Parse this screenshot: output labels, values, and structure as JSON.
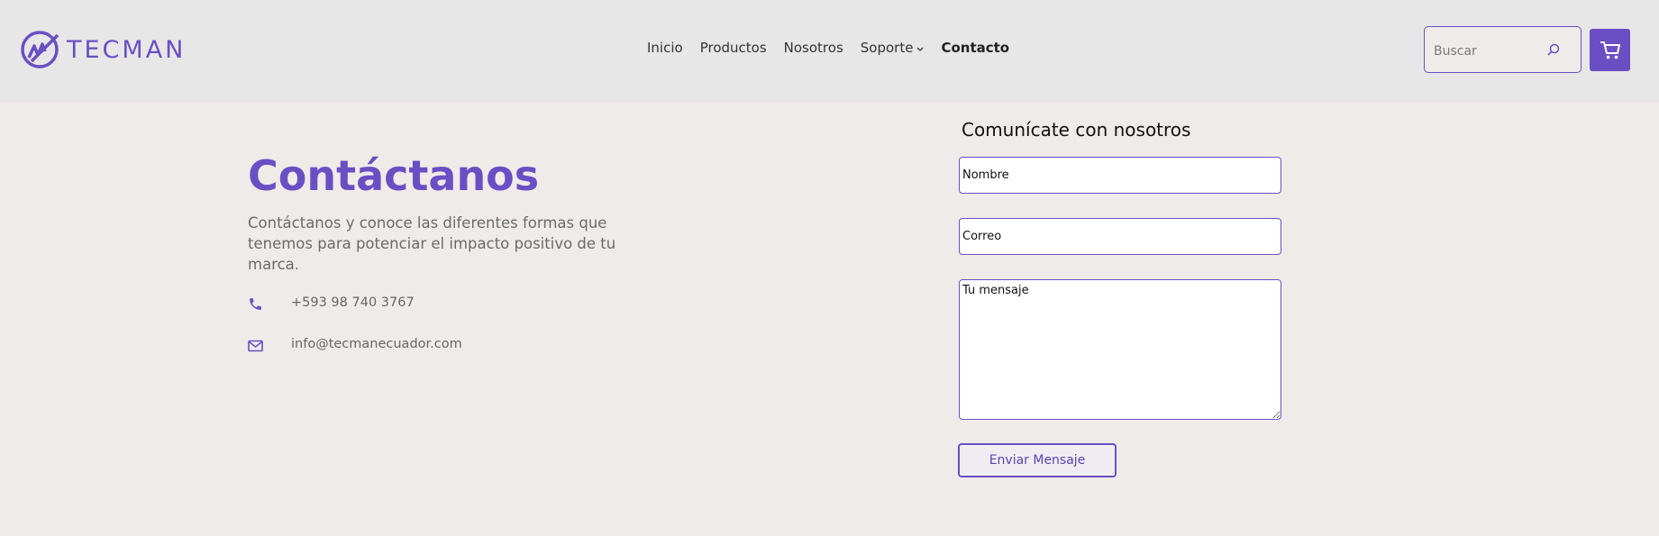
{
  "header": {
    "brand": "TECMAN",
    "nav": [
      {
        "label": "Inicio"
      },
      {
        "label": "Productos"
      },
      {
        "label": "Nosotros"
      },
      {
        "label": "Soporte"
      },
      {
        "label": "Contacto"
      }
    ],
    "search_placeholder": "Buscar"
  },
  "hero": {
    "title": "Contáctanos",
    "description": "Contáctanos y conoce las diferentes formas que tenemos para potenciar el impacto positivo de tu marca."
  },
  "contact": {
    "phone": "+593 98 740 3767",
    "email": "info@tecmanecuador.com"
  },
  "form": {
    "title": "Comunícate con nosotros",
    "name_placeholder": "Nombre",
    "email_placeholder": "Correo",
    "message_placeholder": "Tu mensaje",
    "submit_label": "Enviar Mensaje"
  },
  "colors": {
    "accent": "#6a4fc4",
    "header_bg": "#e7e7e7",
    "page_bg": "#efebe8"
  }
}
